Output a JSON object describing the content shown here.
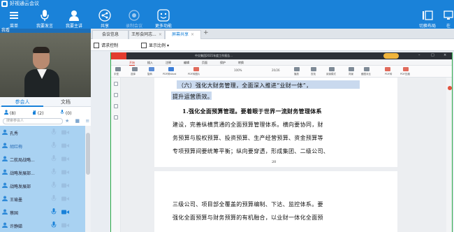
{
  "app": {
    "title": "好视通云会议"
  },
  "toolbar": {
    "menu": "菜单",
    "request_speak": "我要发言",
    "request_host": "我要主讲",
    "share": "共享",
    "record": "录制会议",
    "more": "更多功能",
    "switch_layout": "切换布局",
    "right_cut": "在"
  },
  "left_panel": {
    "header": "我看",
    "tabs": {
      "participants": "参会人",
      "documents": "文档"
    },
    "counts": {
      "participants": "(8)",
      "raised": "(2)",
      "speaking": "(0)"
    },
    "search_placeholder": "搜索参会人",
    "participants": [
      {
        "name": "孔秀"
      },
      {
        "name": "胡红梅"
      },
      {
        "name": "二航局战略..."
      },
      {
        "name": "战略发展部..."
      },
      {
        "name": "战略发展部"
      },
      {
        "name": "王瑜墨"
      },
      {
        "name": "蔡国"
      },
      {
        "name": "许静娣"
      }
    ]
  },
  "main": {
    "tabs": [
      {
        "label": "会议信息"
      },
      {
        "label": "王彤会同志..."
      },
      {
        "label": "屏幕共享"
      }
    ],
    "add_tab": "+",
    "subbar": {
      "request_control": "请求控制",
      "display_ratio": "显示比例"
    }
  },
  "shared_screen": {
    "window_title": "中交集团2021年度工作报告...",
    "menu": [
      "开始",
      "插入",
      "注释",
      "编辑",
      "页面",
      "保护",
      "转换"
    ],
    "zoom": "100%",
    "page_indicator": "20/26",
    "ribbon_items": [
      "手型",
      "选择",
      "旋转",
      "PDF转Word",
      "PDF转图片",
      "播放",
      "查找",
      "阅读模式",
      "背景",
      "截图对比",
      "PDF转",
      "PDF压缩"
    ],
    "page1_lines": [
      "（六）强化大财务管理，全面深入推进“业财一体”，",
      "提升运营质效。",
      "1.强化全面预算管理。要着眼于世界一流财务管理体系",
      "建设，完善纵横贯通的全面预算管理体系。横向要协同，财",
      "务预算与股权预算、投资预算、生产经营预算、资金预算等",
      "专项预算间要统筹平衡；纵向要穿透，形成集团、二级公司、"
    ],
    "page_number": "20",
    "page2_lines": [
      "三级公司、项目部全覆盖的预算编制、下达、监控体系。要",
      "强化全面预算与财务预算的有机融合，以业财一体化全面预"
    ]
  },
  "colors": {
    "accent": "#1a82d9",
    "participant_bg": "#a9d2f2",
    "share_border": "#27a845"
  },
  "icons": [
    "menu-icon",
    "microphone-icon",
    "host-icon",
    "share-icon",
    "record-icon",
    "more-icon",
    "layout-icon",
    "mic-icon",
    "camera-icon",
    "avatar-icon"
  ]
}
